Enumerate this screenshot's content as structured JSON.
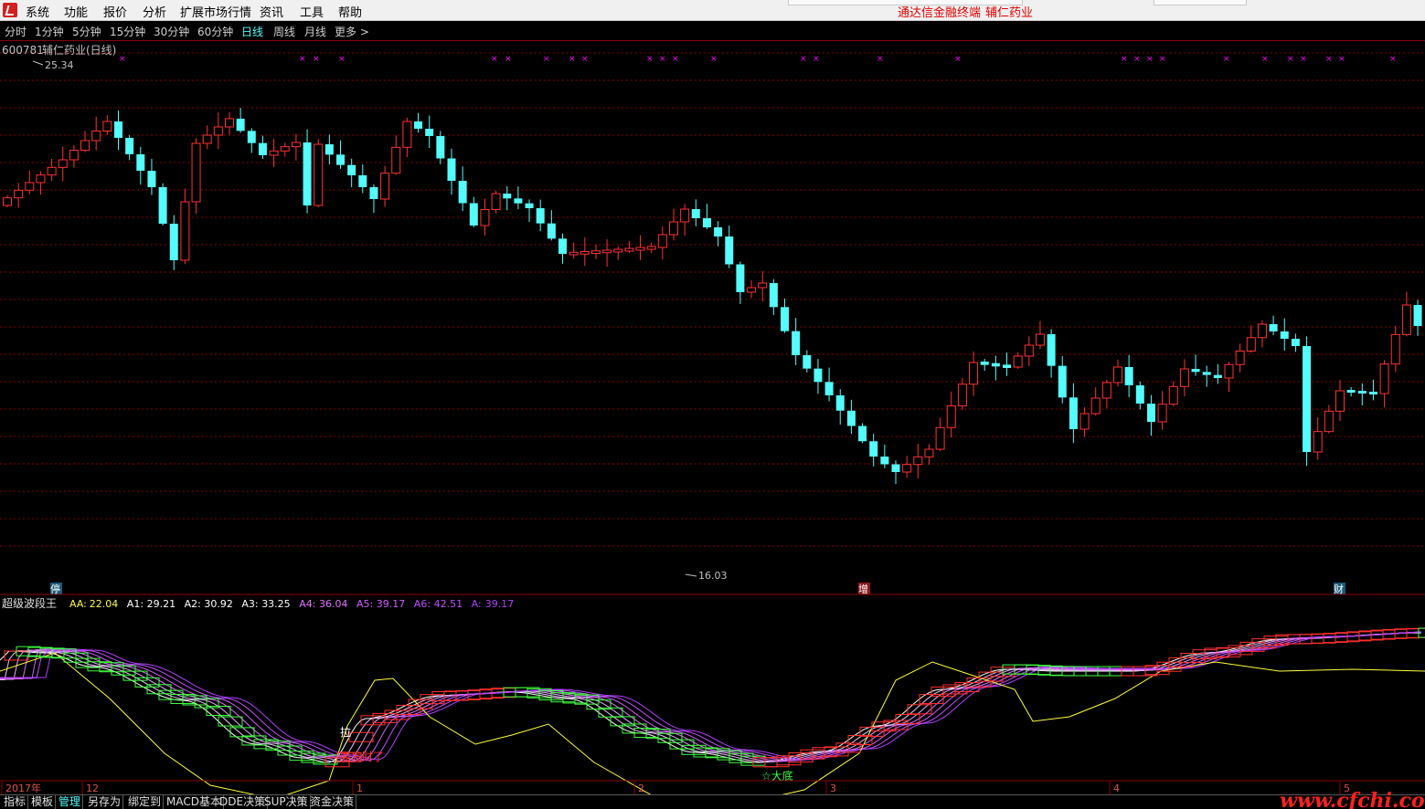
{
  "menu": {
    "items": [
      "系统",
      "功能",
      "报价",
      "分析",
      "扩展市场行情",
      "资讯",
      "工具",
      "帮助"
    ],
    "title_left": "通达信金融终端",
    "title_right": "辅仁药业"
  },
  "periods": {
    "items": [
      "分时",
      "1分钟",
      "5分钟",
      "15分钟",
      "30分钟",
      "60分钟",
      "日线",
      "周线",
      "月线",
      "更多 >"
    ],
    "active": "日线"
  },
  "main_panel": {
    "stock_code": "600781",
    "stock_title": "辅仁药业(日线)",
    "high_label": "25.34",
    "low_label": "16.03",
    "markers": {
      "ting": "停",
      "zeng": "增",
      "cai": "财"
    },
    "colors": {
      "up": "#ff3232",
      "down": "#54fcfc",
      "cross": "#ff00ff",
      "grid": "#8b0000"
    }
  },
  "indicator_panel": {
    "name": "超级波段王",
    "params": [
      {
        "label": "AA:",
        "value": "22.04",
        "color": "#ffff40"
      },
      {
        "label": "A1:",
        "value": "29.21",
        "color": "#ffffff"
      },
      {
        "label": "A2:",
        "value": "30.92",
        "color": "#ffffff"
      },
      {
        "label": "A3:",
        "value": "33.25",
        "color": "#ffffff"
      },
      {
        "label": "A4:",
        "value": "36.04",
        "color": "#e070ff"
      },
      {
        "label": "A5:",
        "value": "39.17",
        "color": "#d060ff"
      },
      {
        "label": "A6:",
        "value": "42.51",
        "color": "#c050ff"
      },
      {
        "label": "A:",
        "value": "39.17",
        "color": "#b040ff"
      }
    ],
    "annotations": {
      "la": "拉",
      "fa": "要发财了",
      "dadi": "☆大底"
    }
  },
  "timeaxis": {
    "labels": [
      "2017年",
      "12",
      "1",
      "2",
      "3",
      "4",
      "5"
    ]
  },
  "bottom_tabs": {
    "items": [
      "指标",
      "模板",
      "管理",
      "另存为",
      "绑定到",
      "MACD基本",
      "DDE决策",
      "SUP决策",
      "资金决策"
    ],
    "active": "管理"
  },
  "watermark": "www.cfchi.com"
}
